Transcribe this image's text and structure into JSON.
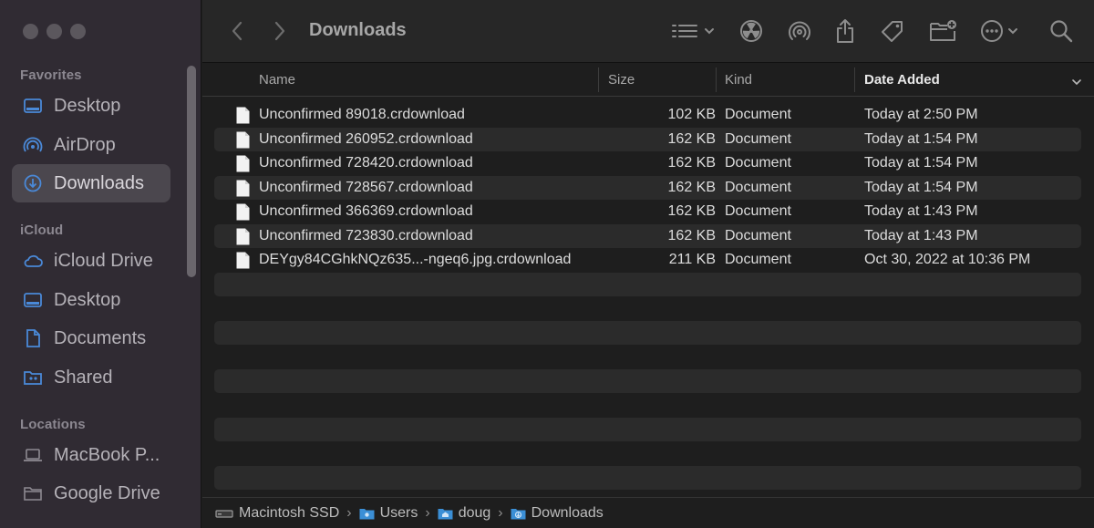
{
  "window": {
    "title": "Downloads"
  },
  "sidebar": {
    "sections": [
      {
        "title": "Favorites"
      },
      {
        "title": "iCloud"
      },
      {
        "title": "Locations"
      }
    ],
    "items": [
      {
        "label": "Desktop",
        "icon": "desktop-icon",
        "section": "Favorites"
      },
      {
        "label": "AirDrop",
        "icon": "airdrop-icon",
        "section": "Favorites"
      },
      {
        "label": "Downloads",
        "icon": "downloads-icon",
        "section": "Favorites",
        "selected": true
      },
      {
        "label": "iCloud Drive",
        "icon": "cloud-icon",
        "section": "iCloud"
      },
      {
        "label": "Desktop",
        "icon": "desktop-icon",
        "section": "iCloud"
      },
      {
        "label": "Documents",
        "icon": "document-icon",
        "section": "iCloud"
      },
      {
        "label": "Shared",
        "icon": "shared-folder-icon",
        "section": "iCloud"
      },
      {
        "label": "MacBook P...",
        "icon": "laptop-icon",
        "section": "Locations"
      },
      {
        "label": "Google Drive",
        "icon": "folder-icon",
        "section": "Locations"
      }
    ]
  },
  "columns": {
    "name": "Name",
    "size": "Size",
    "kind": "Kind",
    "date": "Date Added"
  },
  "files": [
    {
      "name": "Unconfirmed 89018.crdownload",
      "size": "102 KB",
      "kind": "Document",
      "date": "Today at 2:50 PM"
    },
    {
      "name": "Unconfirmed 260952.crdownload",
      "size": "162 KB",
      "kind": "Document",
      "date": "Today at 1:54 PM"
    },
    {
      "name": "Unconfirmed 728420.crdownload",
      "size": "162 KB",
      "kind": "Document",
      "date": "Today at 1:54 PM"
    },
    {
      "name": "Unconfirmed 728567.crdownload",
      "size": "162 KB",
      "kind": "Document",
      "date": "Today at 1:54 PM"
    },
    {
      "name": "Unconfirmed 366369.crdownload",
      "size": "162 KB",
      "kind": "Document",
      "date": "Today at 1:43 PM"
    },
    {
      "name": "Unconfirmed 723830.crdownload",
      "size": "162 KB",
      "kind": "Document",
      "date": "Today at 1:43 PM"
    },
    {
      "name": "DEYgy84CGhkNQz635...-ngeq6.jpg.crdownload",
      "size": "211 KB",
      "kind": "Document",
      "date": "Oct 30, 2022 at 10:36 PM"
    }
  ],
  "pathbar": {
    "crumbs": [
      "Macintosh SSD",
      "Users",
      "doug",
      "Downloads"
    ]
  }
}
